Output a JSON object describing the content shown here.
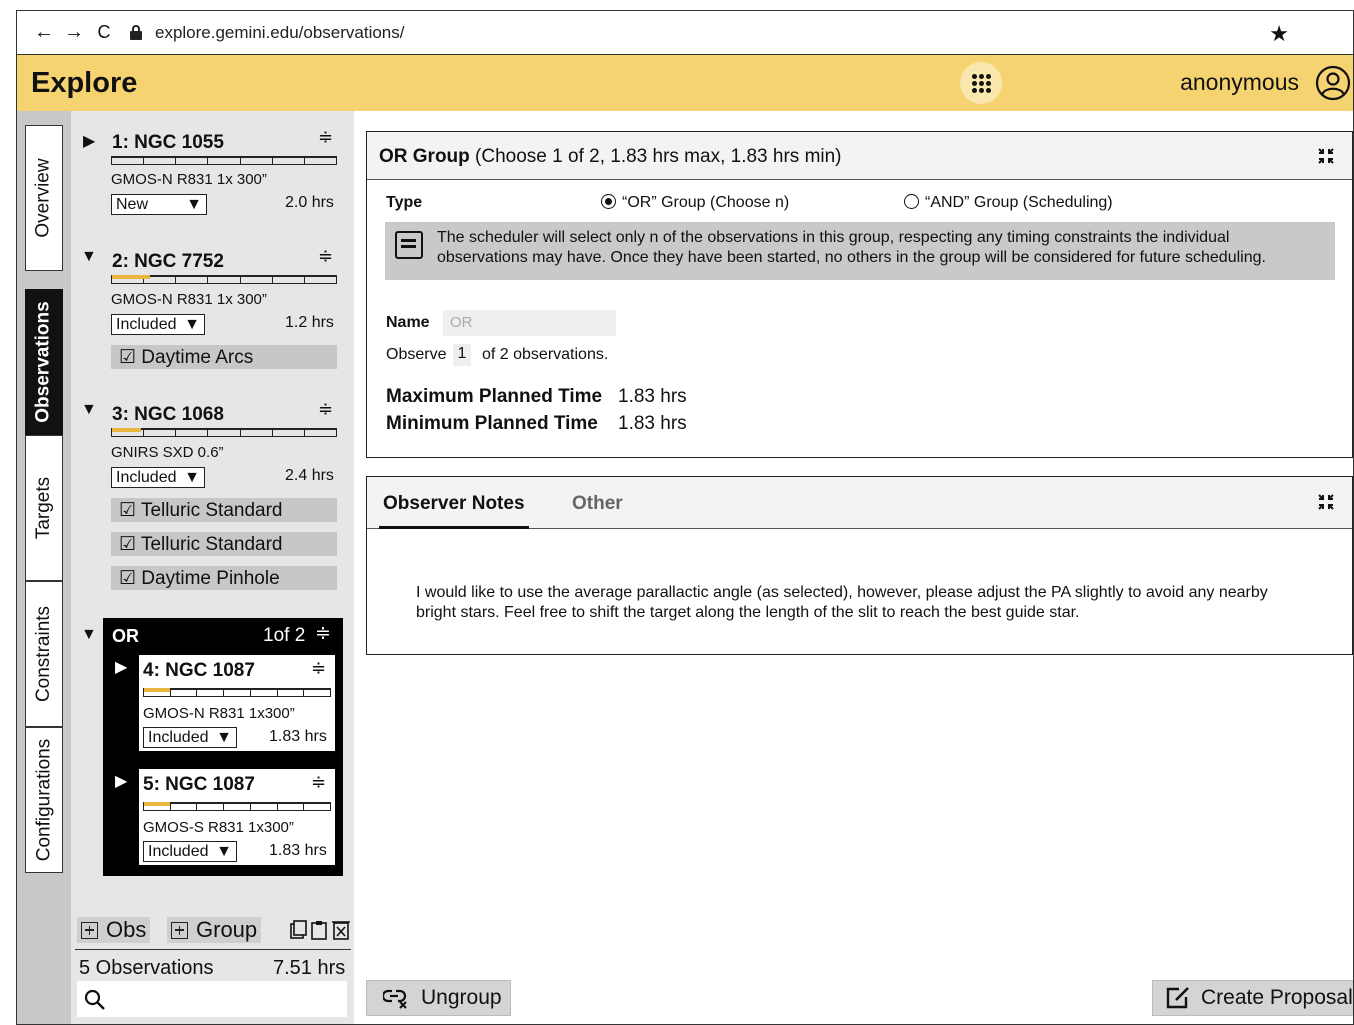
{
  "browser": {
    "url": "explore.gemini.edu/observations/",
    "back": "←",
    "forward": "→",
    "reload": "C",
    "star": "★"
  },
  "header": {
    "title": "Explore",
    "user": "anonymous"
  },
  "rail": {
    "tabs": [
      "Overview",
      "Observations",
      "Targets",
      "Constraints",
      "Configurations"
    ],
    "active": "Observations"
  },
  "tree": {
    "observations": [
      {
        "title": "1: NGC 1055",
        "expanded": false,
        "config": "GMOS-N R831 1x 300”",
        "status": "New",
        "hours": "2.0 hrs",
        "progress": 0,
        "calibrations": []
      },
      {
        "title": "2: NGC 7752",
        "expanded": true,
        "config": "GMOS-N R831 1x 300”",
        "status": "Included",
        "hours": "1.2 hrs",
        "progress": 0.17,
        "calibrations": [
          "☑ Daytime Arcs"
        ]
      },
      {
        "title": "3: NGC 1068",
        "expanded": true,
        "config": "GNIRS SXD 0.6”",
        "status": "Included",
        "hours": "2.4 hrs",
        "progress": 0.13,
        "calibrations": [
          "☑ Telluric Standard",
          "☑ Telluric Standard",
          "☑ Daytime Pinhole"
        ]
      }
    ],
    "or_group": {
      "label": "OR",
      "count": "1of 2",
      "children": [
        {
          "title": "4: NGC 1087",
          "config": "GMOS-N R831 1x300”",
          "status": "Included",
          "hours": "1.83 hrs",
          "progress": 0.14
        },
        {
          "title": "5: NGC 1087",
          "config": "GMOS-S R831 1x300”",
          "status": "Included",
          "hours": "1.83 hrs",
          "progress": 0.14
        }
      ]
    },
    "footer": {
      "add_obs": "Obs",
      "add_group": "Group",
      "summary_count": "5 Observations",
      "summary_hours": "7.51 hrs",
      "search_placeholder": ""
    }
  },
  "group_panel": {
    "title_bold": "OR Group",
    "title_rest": " (Choose 1 of 2, 1.83 hrs max, 1.83 hrs min)",
    "type_label": "Type",
    "option_or": "“OR” Group (Choose n)",
    "option_and": "“AND” Group (Scheduling)",
    "info_line1": "The  scheduler will select only n of the observations in this group, respecting any timing constraints the individual",
    "info_line2": "observations may have.  Once they have been started, no others in the group will be considered for future scheduling.",
    "name_label": "Name",
    "name_value": "OR",
    "observe_prefix": "Observe",
    "observe_value": "1",
    "observe_suffix": "of 2 observations.",
    "max_label": "Maximum Planned Time",
    "max_value": "1.83 hrs",
    "min_label": "Minimum Planned Time",
    "min_value": "1.83 hrs"
  },
  "notes_panel": {
    "tabs": [
      "Observer Notes",
      "Other"
    ],
    "active_tab": "Observer Notes",
    "text_line1": "I would like to use the average parallactic angle (as selected), however, please adjust the PA slightly to avoid any nearby",
    "text_line2": "bright stars.  Feel free to shift the target along the length of the slit to reach the best guide star."
  },
  "actions": {
    "ungroup": "Ungroup",
    "create_proposal": "Create Proposal"
  },
  "colors": {
    "header_bg": "#f6d371",
    "progress_fill": "#e9b63e",
    "active_tab": "#111111"
  }
}
